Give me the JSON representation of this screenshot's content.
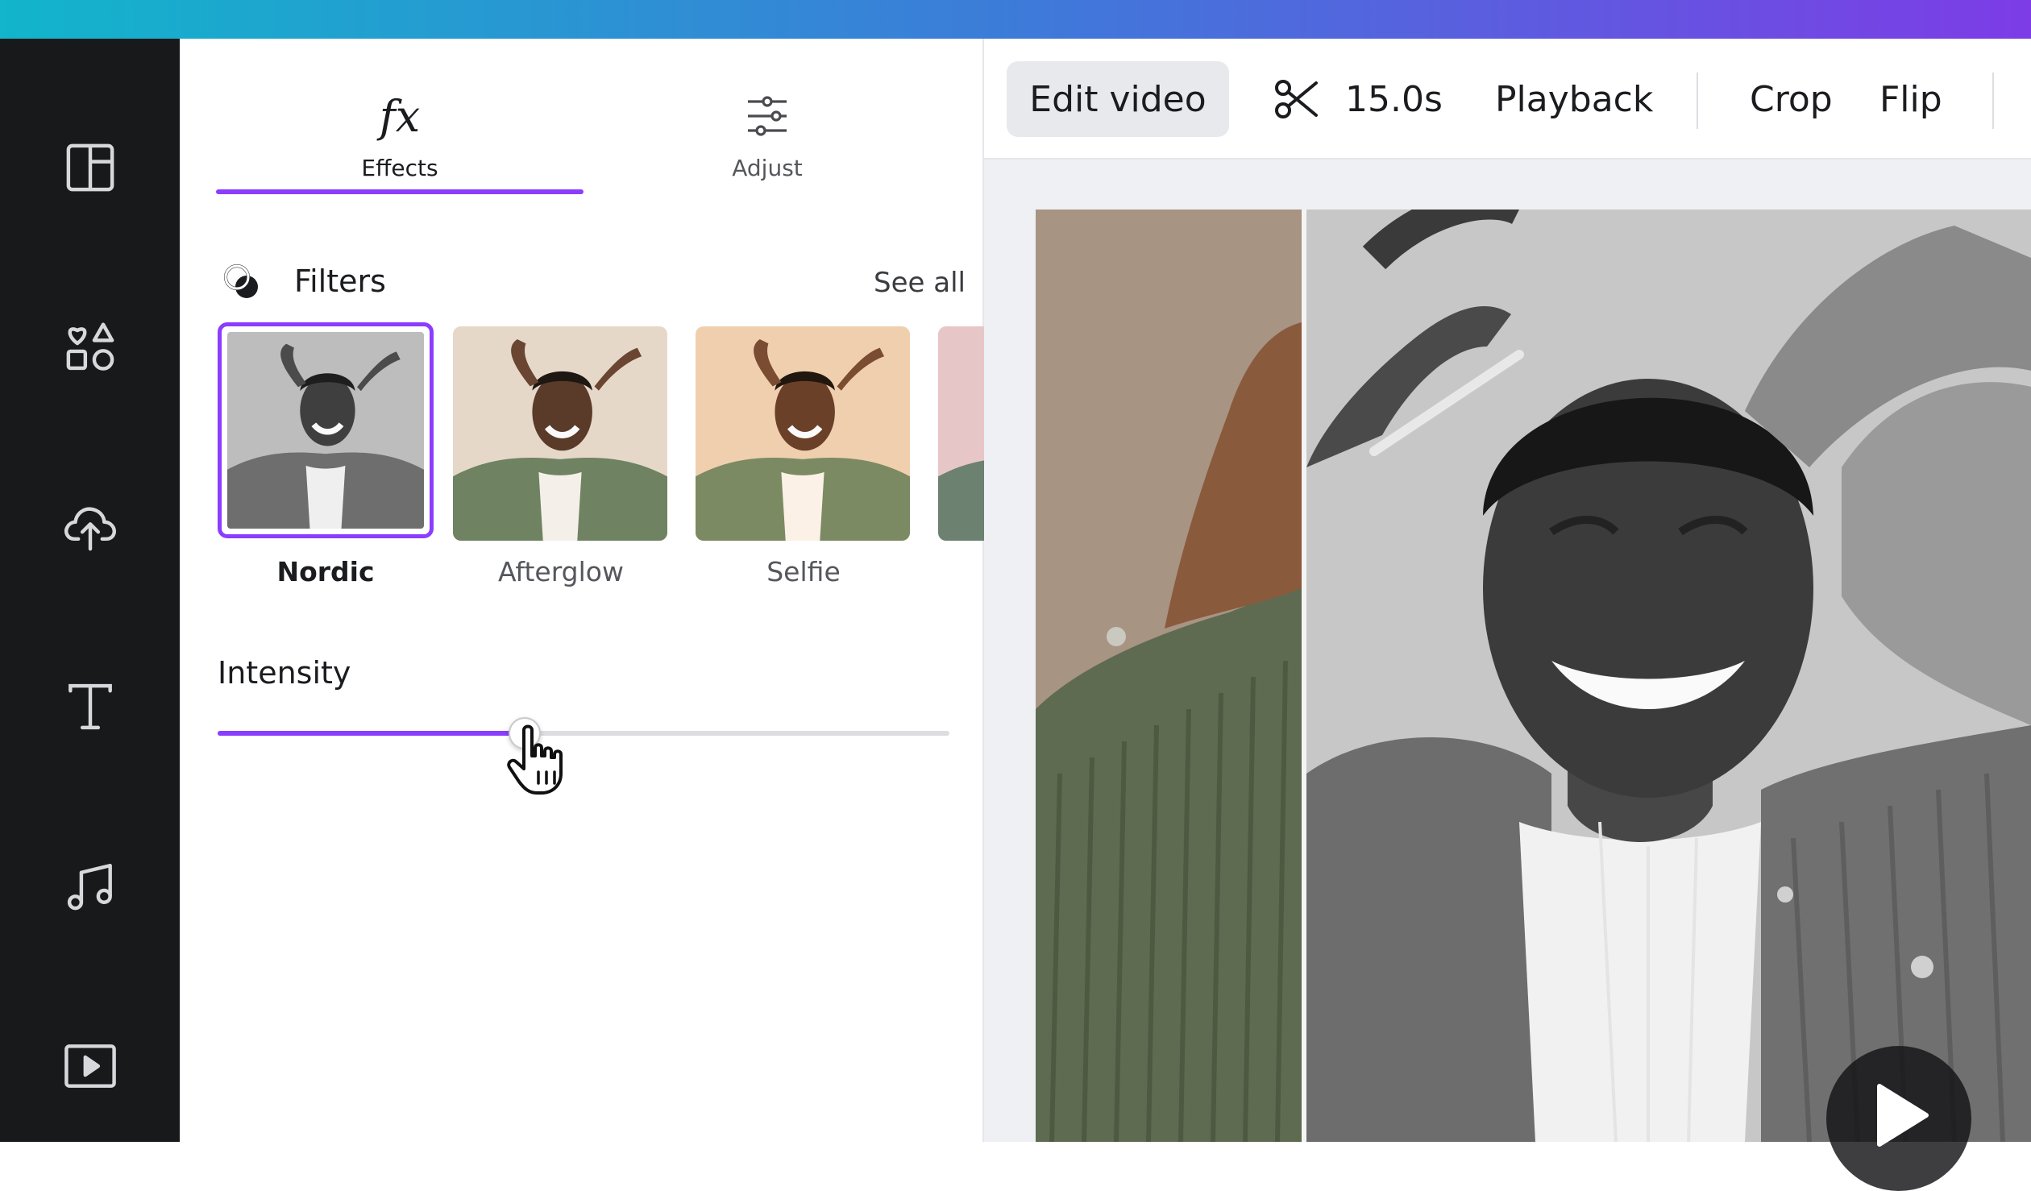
{
  "panel": {
    "tabs": [
      {
        "label": "Effects",
        "icon": "fx-icon",
        "active": true
      },
      {
        "label": "Adjust",
        "icon": "sliders-icon",
        "active": false
      }
    ],
    "fx_glyph": "fx",
    "filters": {
      "title": "Filters",
      "see_all": "See all",
      "items": [
        {
          "label": "Nordic",
          "selected": true
        },
        {
          "label": "Afterglow",
          "selected": false
        },
        {
          "label": "Selfie",
          "selected": false
        }
      ]
    },
    "intensity": {
      "label": "Intensity",
      "value_percent": 42
    }
  },
  "toolbar": {
    "edit_video": "Edit video",
    "duration": "15.0s",
    "playback": "Playback",
    "crop": "Crop",
    "flip": "Flip"
  },
  "sidebar": {
    "icons": [
      "templates-icon",
      "elements-icon",
      "uploads-icon",
      "text-icon",
      "audio-icon",
      "videos-icon"
    ]
  },
  "colors": {
    "accent": "#8b3dff",
    "rail_bg": "#18191b",
    "gradient_start": "#12b5cb",
    "gradient_end": "#7d3ce6"
  }
}
